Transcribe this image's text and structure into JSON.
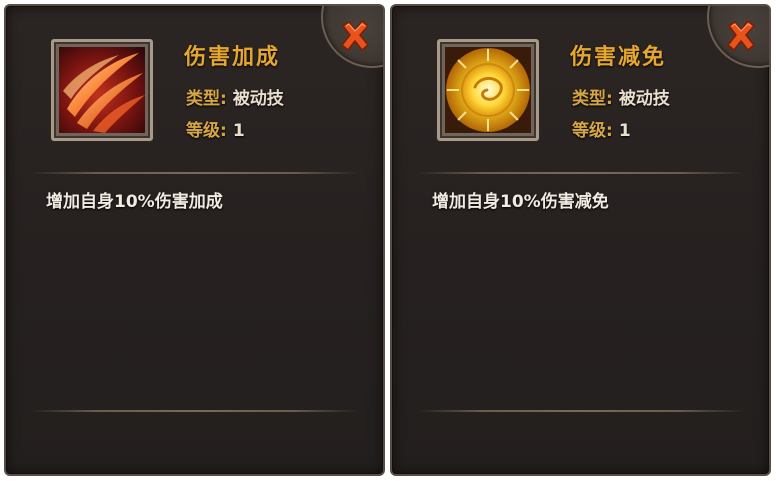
{
  "panels": [
    {
      "name": "伤害加成",
      "type_label": "类型:",
      "type_value": "被动技",
      "level_label": "等级:",
      "level_value": "1",
      "description": "增加自身10%伤害加成",
      "icon": "red-slash-icon"
    },
    {
      "name": "伤害减免",
      "type_label": "类型:",
      "type_value": "被动技",
      "level_label": "等级:",
      "level_value": "1",
      "description": "增加自身10%伤害减免",
      "icon": "golden-shield-icon"
    }
  ],
  "colors": {
    "title": "#e6a72f",
    "label": "#d7a644",
    "close": "#e8531c",
    "panel_bg": "#262120"
  }
}
